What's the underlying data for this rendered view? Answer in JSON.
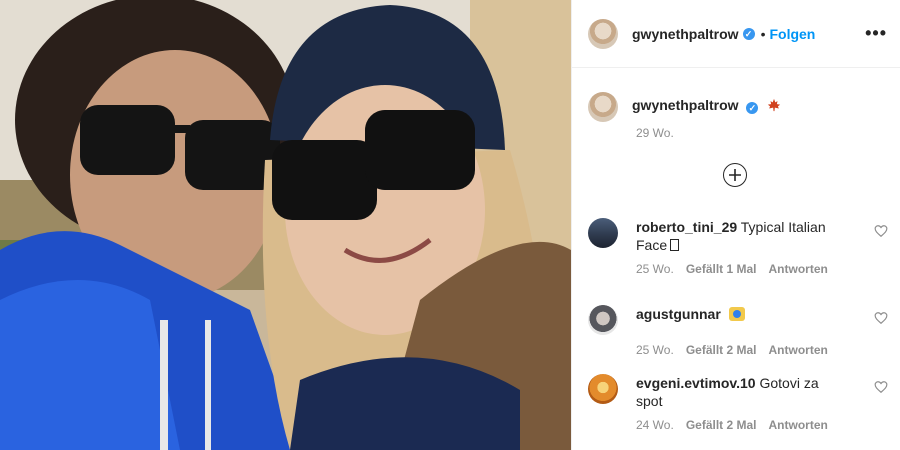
{
  "header": {
    "username": "gwynethpaltrow",
    "verified_icon": "verified-badge-icon",
    "separator": "•",
    "follow_label": "Folgen",
    "more_icon": "more-options-icon",
    "more_label": "•••"
  },
  "caption": {
    "username": "gwynethpaltrow",
    "emoji_icon": "maple-leaf-icon",
    "time": "29 Wo."
  },
  "load_more_icon": "plus-circle-icon",
  "comments": [
    {
      "username": "roberto_tini_29",
      "text": "Typical Italian Face",
      "time": "25 Wo.",
      "likes": "Gefällt 1 Mal",
      "reply": "Antworten"
    },
    {
      "username": "agustgunnar",
      "text": "",
      "time": "25 Wo.",
      "likes": "Gefällt 2 Mal",
      "reply": "Antworten"
    },
    {
      "username": "evgeni.evtimov.10",
      "text": "Gotovi za spot",
      "time": "24 Wo.",
      "likes": "Gefällt 2 Mal",
      "reply": "Antworten"
    }
  ],
  "colors": {
    "link_blue": "#0095f6",
    "verified_blue": "#3897f0",
    "muted_text": "#8e8e8e",
    "leaf_red": "#d1421f"
  }
}
